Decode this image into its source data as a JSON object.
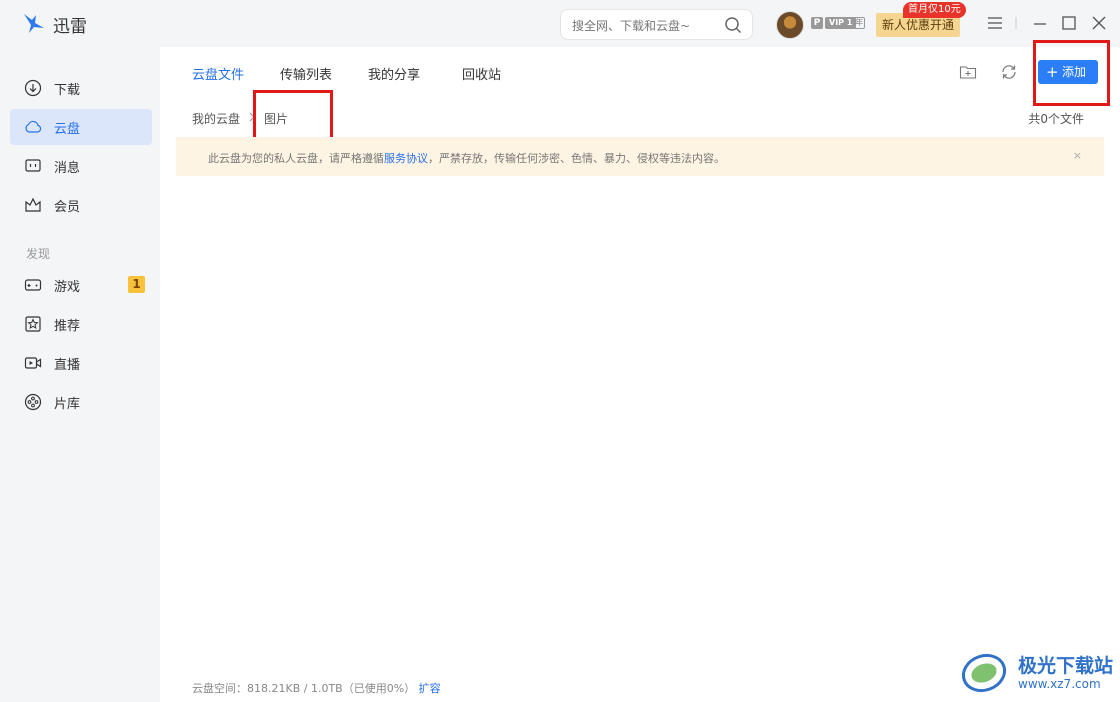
{
  "app": {
    "name": "迅雷"
  },
  "header": {
    "search_placeholder": "搜全网、下载和云盘~",
    "badges": {
      "p": "P",
      "vip": "VIP 1",
      "year": "年"
    },
    "promo_label": "新人优惠开通",
    "promo_tag": "首月仅10元"
  },
  "sidebar": {
    "items": [
      {
        "label": "下载",
        "icon": "download-icon"
      },
      {
        "label": "云盘",
        "icon": "cloud-icon",
        "active": true
      },
      {
        "label": "消息",
        "icon": "message-icon"
      },
      {
        "label": "会员",
        "icon": "crown-icon"
      }
    ],
    "section_label": "发现",
    "discover_items": [
      {
        "label": "游戏",
        "icon": "gamepad-icon",
        "badge": "1"
      },
      {
        "label": "推荐",
        "icon": "star-icon"
      },
      {
        "label": "直播",
        "icon": "live-video-icon"
      },
      {
        "label": "片库",
        "icon": "film-reel-icon"
      }
    ]
  },
  "main": {
    "tabs": [
      "云盘文件",
      "传输列表",
      "我的分享",
      "回收站"
    ],
    "add_label": "添加",
    "breadcrumb": {
      "root": "我的云盘",
      "current": "图片"
    },
    "file_count": "共0个文件",
    "notice": {
      "before": "此云盘为您的私人云盘，请严格遵循",
      "link": "服务协议",
      "after": "，严禁存放，传输任何涉密、色情、暴力、侵权等违法内容。",
      "close": "×"
    },
    "footer": {
      "space": "云盘空间：818.21KB / 1.0TB（已使用0%）",
      "expand": "扩容"
    }
  },
  "watermark": {
    "name": "极光下载站",
    "url": "www.xz7.com"
  },
  "colors": {
    "accent": "#2670ea",
    "add_button": "#2c7ef8",
    "highlight_box": "#e01818",
    "notice_bg": "#fdf4e3"
  }
}
